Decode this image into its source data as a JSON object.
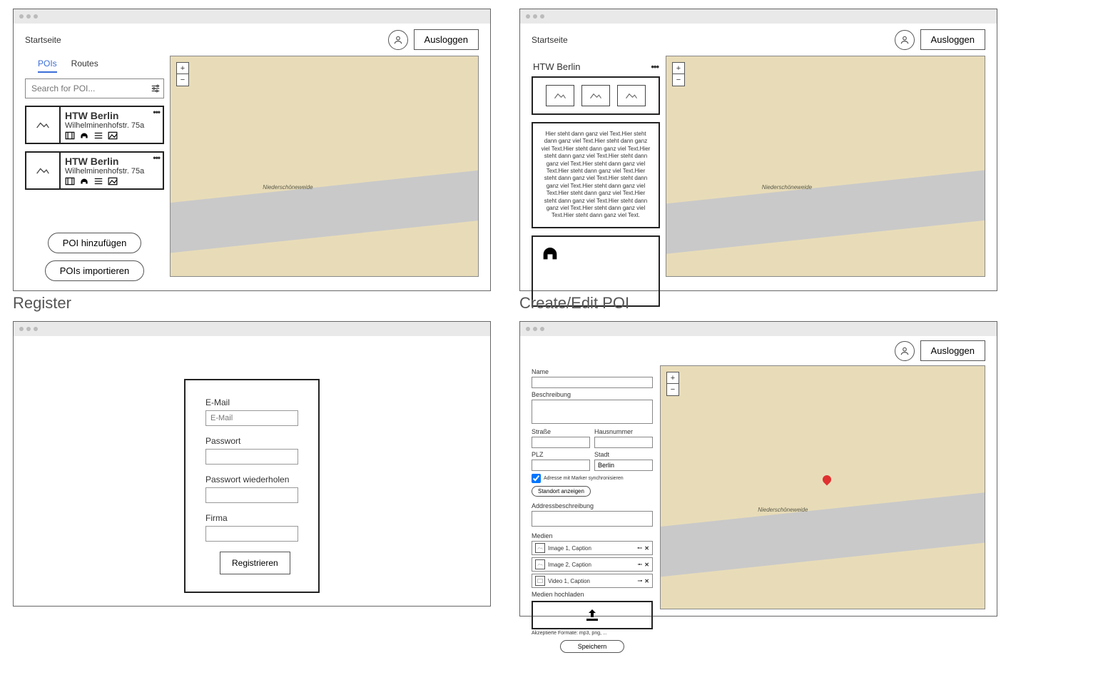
{
  "common": {
    "startseite": "Startseite",
    "logout": "Ausloggen",
    "zoom_in": "+",
    "zoom_out": "−"
  },
  "window1": {
    "tabs": {
      "pois": "POIs",
      "routes": "Routes"
    },
    "search_placeholder": "Search for POI...",
    "poi_cards": [
      {
        "title": "HTW Berlin",
        "addr": "Wilhelminenhofstr. 75a"
      },
      {
        "title": "HTW Berlin",
        "addr": "Wilhelminenhofstr. 75a"
      }
    ],
    "add_poi": "POI hinzufügen",
    "import_poi": "POIs importieren"
  },
  "window2": {
    "detail_title": "HTW Berlin",
    "lorem": "Hier steht dann ganz viel Text.Hier steht dann ganz viel Text.Hier steht dann ganz viel Text.Hier steht dann ganz viel Text.Hier steht dann ganz viel Text.Hier steht dann ganz viel Text.Hier steht dann ganz viel Text.Hier steht dann ganz viel Text.Hier steht dann ganz viel Text.Hier steht dann ganz viel Text.Hier steht dann ganz viel Text.Hier steht dann ganz viel Text.Hier steht dann ganz viel Text.Hier steht dann ganz viel Text.Hier steht dann ganz viel Text.Hier steht dann ganz viel Text."
  },
  "captions": {
    "register": "Register",
    "createedit": "Create/Edit POI"
  },
  "window3": {
    "email_label": "E-Mail",
    "email_placeholder": "E-Mail",
    "password_label": "Passwort",
    "password2_label": "Passwort wiederholen",
    "company_label": "Firma",
    "register_btn": "Registrieren"
  },
  "window4": {
    "name_label": "Name",
    "desc_label": "Beschreibung",
    "street_label": "Straße",
    "houseno_label": "Hausnummer",
    "plz_label": "PLZ",
    "city_label": "Stadt",
    "city_value": "Berlin",
    "sync_label": "Adresse mit Marker synchronisieren",
    "show_loc": "Standort anzeigen",
    "addr_desc_label": "Addressbeschreibung",
    "media_label": "Medien",
    "media": [
      {
        "caption": "Image 1, Caption",
        "type": "image"
      },
      {
        "caption": "Image 2, Caption",
        "type": "image"
      },
      {
        "caption": "Video 1, Caption",
        "type": "video"
      }
    ],
    "upload_label": "Medien hochladen",
    "formats": "Akzeptierte Formate: mp3, png, ...",
    "save": "Speichern"
  },
  "map_labels": {
    "l1": "Niederschöneweide"
  }
}
